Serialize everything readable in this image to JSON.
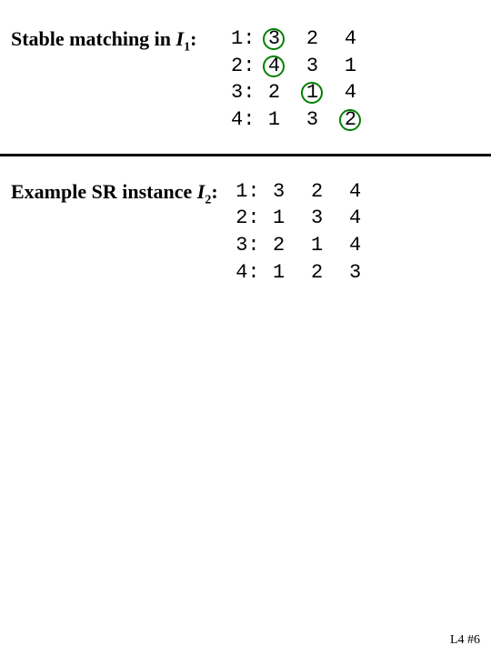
{
  "top": {
    "label_pre": "Stable matching in ",
    "label_var": "I",
    "label_sub": "1",
    "label_post": ":",
    "rows": [
      {
        "label": "1:",
        "cells": [
          {
            "v": "3",
            "c": true
          },
          {
            "v": "2",
            "c": false
          },
          {
            "v": "4",
            "c": false
          }
        ]
      },
      {
        "label": "2:",
        "cells": [
          {
            "v": "4",
            "c": true
          },
          {
            "v": "3",
            "c": false
          },
          {
            "v": "1",
            "c": false
          }
        ]
      },
      {
        "label": "3:",
        "cells": [
          {
            "v": "2",
            "c": false
          },
          {
            "v": "1",
            "c": true
          },
          {
            "v": "4",
            "c": false
          }
        ]
      },
      {
        "label": "4:",
        "cells": [
          {
            "v": "1",
            "c": false
          },
          {
            "v": "3",
            "c": false
          },
          {
            "v": "2",
            "c": true
          }
        ]
      }
    ]
  },
  "bottom": {
    "label_pre": "Example SR instance ",
    "label_var": "I",
    "label_sub": "2",
    "label_post": ":",
    "rows": [
      {
        "label": "1:",
        "cells": [
          {
            "v": "3"
          },
          {
            "v": "2"
          },
          {
            "v": "4"
          }
        ]
      },
      {
        "label": "2:",
        "cells": [
          {
            "v": "1"
          },
          {
            "v": "3"
          },
          {
            "v": "4"
          }
        ]
      },
      {
        "label": "3:",
        "cells": [
          {
            "v": "2"
          },
          {
            "v": "1"
          },
          {
            "v": "4"
          }
        ]
      },
      {
        "label": "4:",
        "cells": [
          {
            "v": "1"
          },
          {
            "v": "2"
          },
          {
            "v": "3"
          }
        ]
      }
    ]
  },
  "footer": "L4 #6",
  "colors": {
    "circle": "#008000"
  }
}
